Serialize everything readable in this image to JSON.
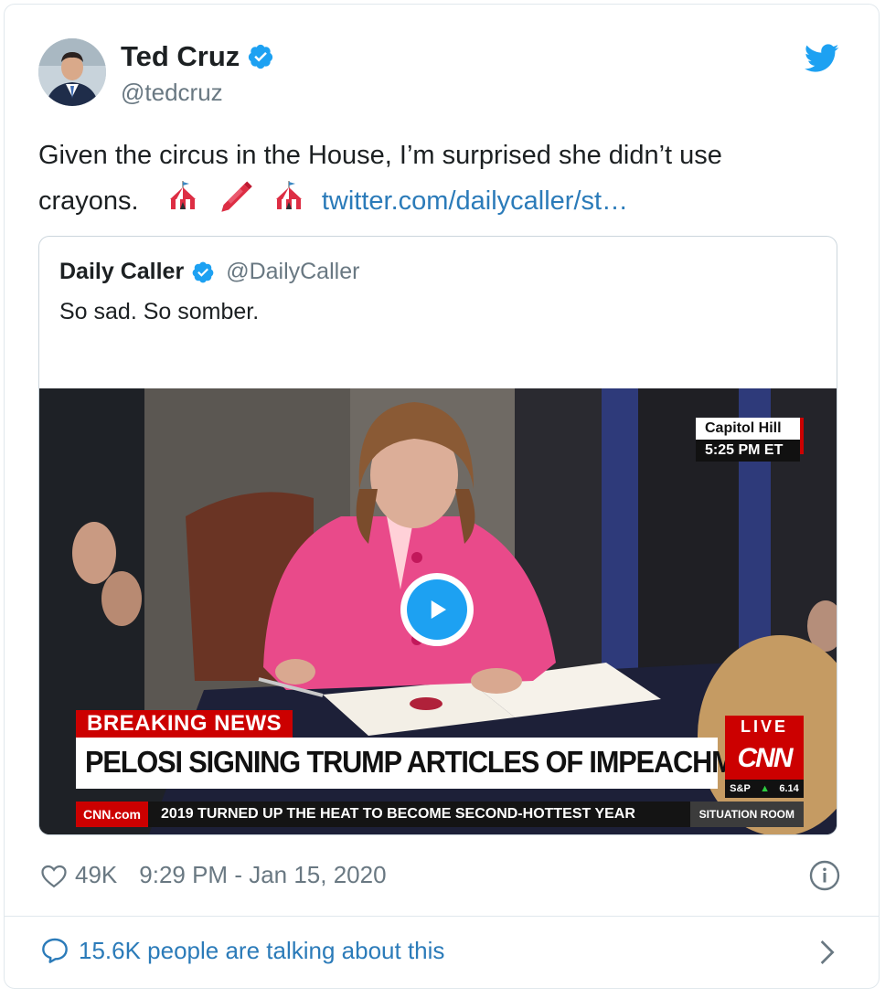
{
  "author": {
    "name": "Ted Cruz",
    "handle": "@tedcruz"
  },
  "tweet": {
    "text_line1": "Given the circus in the House, I’m surprised she didn’t use",
    "text_line2_start": "crayons.",
    "link": "twitter.com/dailycaller/st…",
    "emojis": [
      "circus-tent-icon",
      "crayon-icon",
      "circus-tent-icon"
    ]
  },
  "quoted": {
    "name": "Daily Caller",
    "handle": "@DailyCaller",
    "text": "So sad. So somber."
  },
  "video": {
    "location": "Capitol Hill",
    "time": "5:25 PM ET",
    "breaking": "BREAKING NEWS",
    "headline": "PELOSI SIGNING TRUMP ARTICLES OF IMPEACHMENT",
    "live": "LIVE",
    "network": "CNN",
    "ticker_site": "CNN.com",
    "ticker": "2019 TURNED UP THE HEAT TO BECOME SECOND-HOTTEST YEAR",
    "show": "SITUATION ROOM",
    "market": "S&P",
    "market_value": "6.14"
  },
  "meta": {
    "likes": "49K",
    "timestamp": "9:29 PM - Jan 15, 2020"
  },
  "talking": "15.6K people are talking about this",
  "colors": {
    "twitter_blue": "#1da1f2",
    "link": "#2b7bb9",
    "cnn_red": "#cc0000",
    "pink_jacket": "#e94a8a"
  }
}
